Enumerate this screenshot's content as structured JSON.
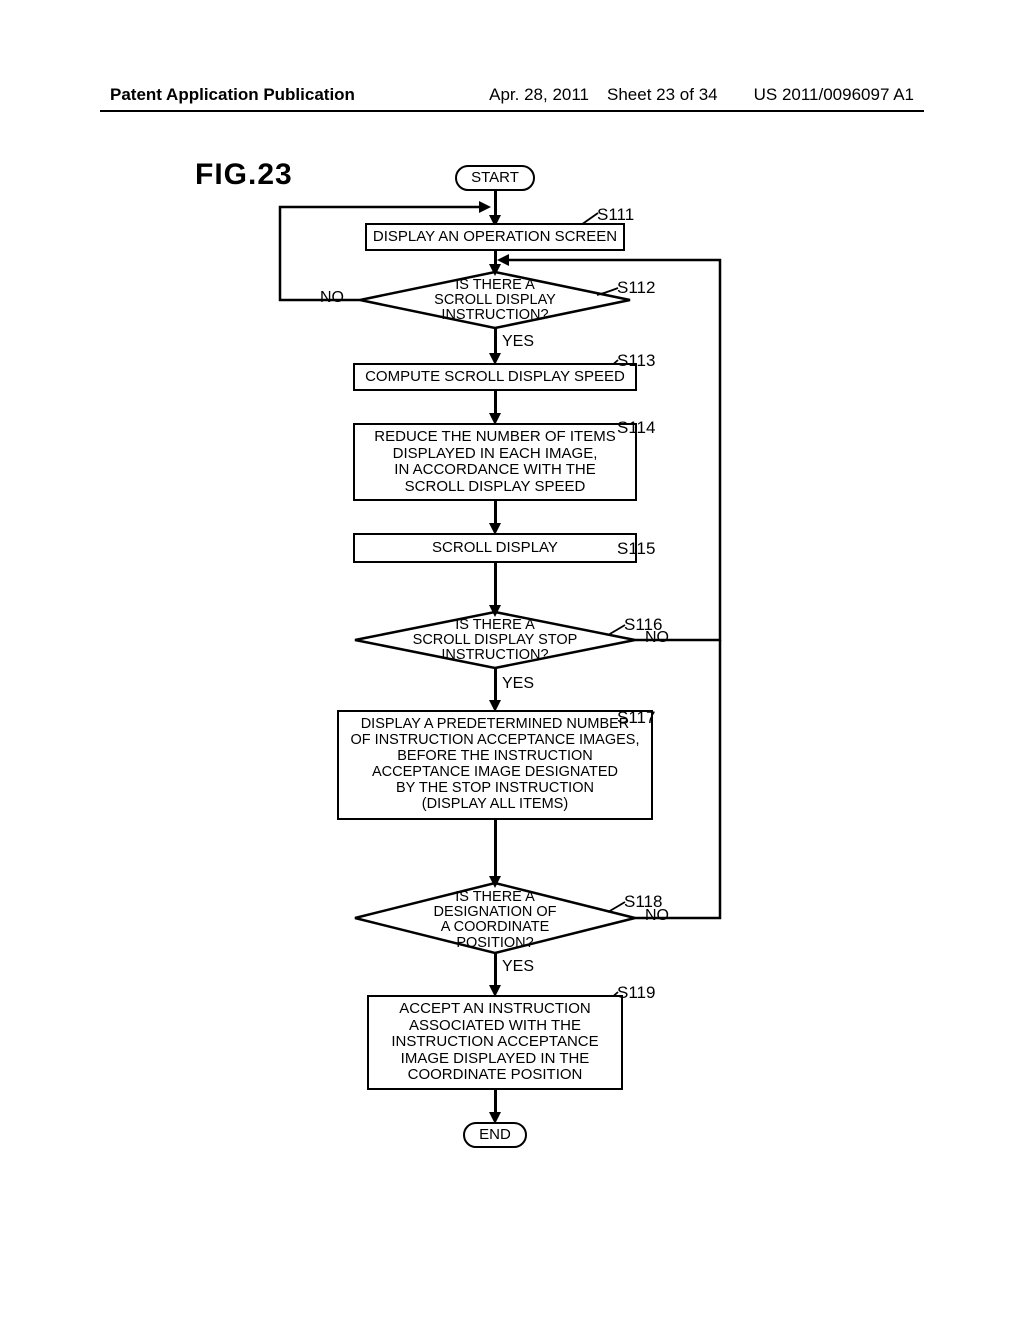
{
  "header": {
    "left": "Patent Application Publication",
    "date": "Apr. 28, 2011",
    "sheet": "Sheet 23 of 34",
    "pubno": "US 2011/0096097 A1"
  },
  "figure_label": "FIG.23",
  "nodes": {
    "start": "START",
    "s111": "DISPLAY AN OPERATION SCREEN",
    "s112": "IS THERE A\nSCROLL DISPLAY\nINSTRUCTION?",
    "s113": "COMPUTE SCROLL DISPLAY SPEED",
    "s114": "REDUCE THE NUMBER OF ITEMS\nDISPLAYED IN EACH IMAGE,\nIN ACCORDANCE WITH THE\nSCROLL DISPLAY SPEED",
    "s115": "SCROLL DISPLAY",
    "s116": "IS THERE A\nSCROLL DISPLAY STOP\nINSTRUCTION?",
    "s117": "DISPLAY A PREDETERMINED NUMBER\nOF INSTRUCTION ACCEPTANCE IMAGES,\nBEFORE THE INSTRUCTION\nACCEPTANCE IMAGE DESIGNATED\nBY THE STOP INSTRUCTION\n(DISPLAY ALL ITEMS)",
    "s118": "IS THERE A\nDESIGNATION OF\nA COORDINATE\nPOSITION?",
    "s119": "ACCEPT AN INSTRUCTION\nASSOCIATED WITH THE\nINSTRUCTION ACCEPTANCE\nIMAGE DISPLAYED IN THE\nCOORDINATE POSITION",
    "end": "END"
  },
  "labels": {
    "s111": "S111",
    "s112": "S112",
    "s113": "S113",
    "s114": "S114",
    "s115": "S115",
    "s116": "S116",
    "s117": "S117",
    "s118": "S118",
    "s119": "S119",
    "yes": "YES",
    "no": "NO"
  }
}
